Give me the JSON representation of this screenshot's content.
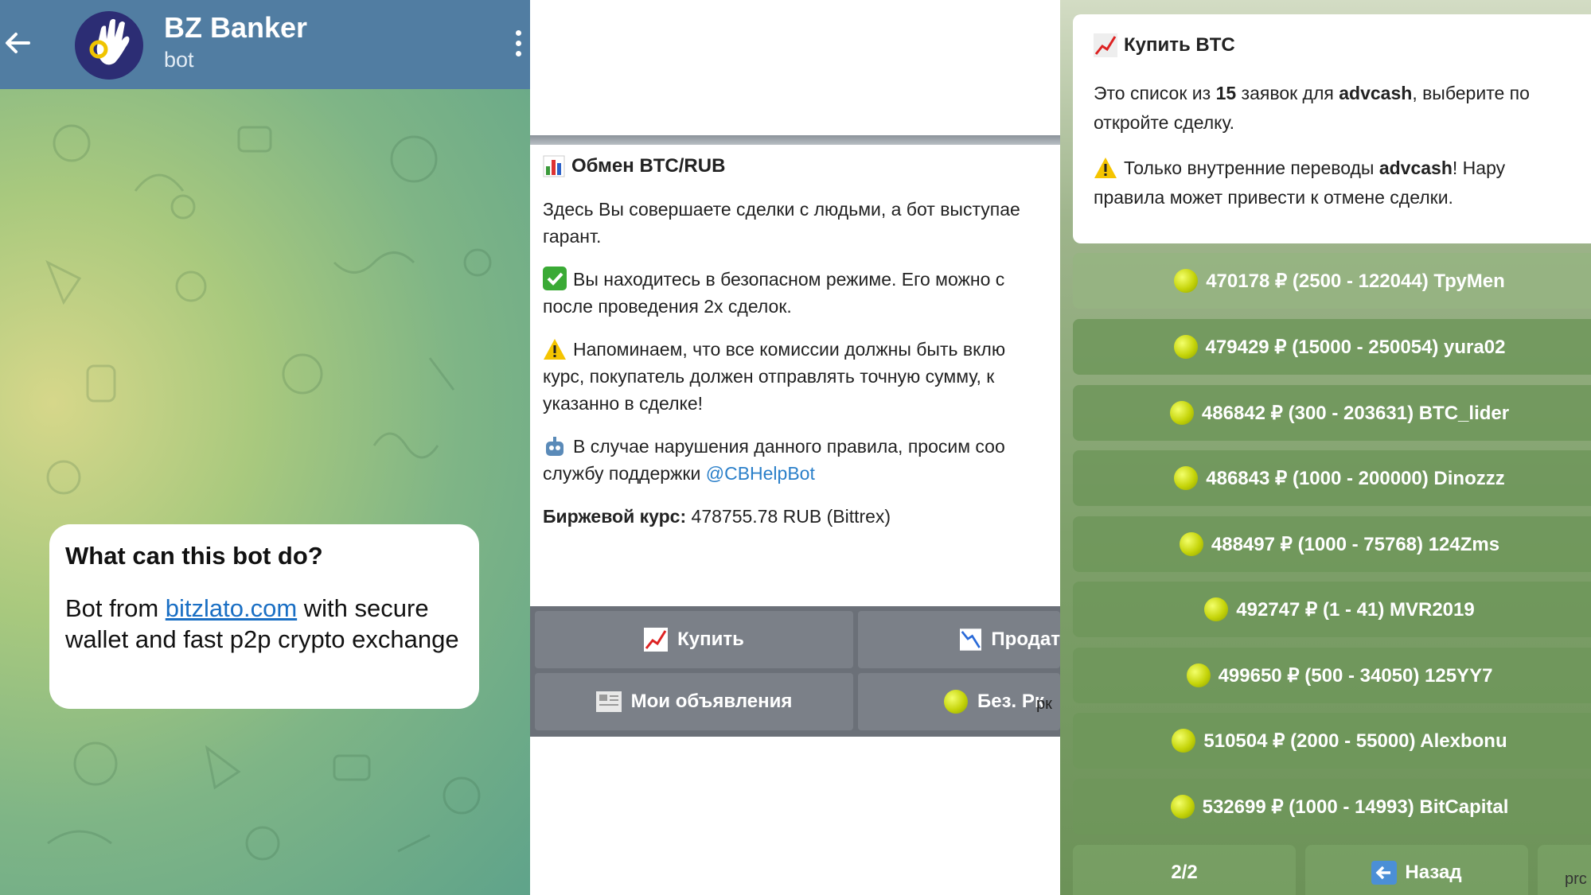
{
  "chat": {
    "title": "BZ Banker",
    "subtitle": "bot",
    "bubble_heading": "What can this bot do?",
    "bubble_prefix": "Bot from ",
    "bubble_link": "bitzlato.com",
    "bubble_suffix": " with secure wallet and fast p2p crypto exchange"
  },
  "exchange": {
    "title": "Обмен BTC/RUB",
    "intro": [
      "Здесь Вы совершаете сделки с людьми, а бот выступае",
      "гарант."
    ],
    "safe_mode": [
      "Вы находитесь в безопасном режиме. Его можно с",
      "после проведения 2х сделок."
    ],
    "reminder": [
      "Напоминаем, что все комиссии должны быть вклю",
      "курс, покупатель должен отправлять точную сумму, к",
      "указанно в сделке!"
    ],
    "violation": [
      "В случае нарушения данного правила, просим соо",
      "службу поддержки "
    ],
    "support_handle": "@CBHelpBot",
    "rate_label": "Биржевой курс:",
    "rate_value": " 478755.78 RUB (Bittrex)",
    "buttons": {
      "buy": "Купить",
      "sell": "Продат",
      "my_ads": "Мои объявления",
      "no_rk": "Без. Рк",
      "small_tag": "рк"
    }
  },
  "buy_btc": {
    "title": "Купить BTC",
    "list_prefix": "Это список из ",
    "list_count": "15",
    "list_mid": " заявок для ",
    "list_method": "advcash",
    "list_suffix": ", выберите по",
    "list_line2": "откройте сделку.",
    "warn_prefix": "Только внутренние переводы ",
    "warn_method": "advcash",
    "warn_suffix": "! Нару",
    "warn_line2": "правила может привести к отмене сделки.",
    "offers": [
      "470178 ₽ (2500 - 122044) ТруМеn",
      "479429 ₽ (15000 - 250054) yura02",
      "486842 ₽ (300 - 203631) BTC_lider",
      "486843 ₽ (1000 - 200000) Dinozzz",
      "488497 ₽ (1000 - 75768) 124Zms",
      "492747 ₽ (1 - 41) MVR2019",
      "499650 ₽ (500 - 34050) 125YY7",
      "510504 ₽ (2000 - 55000) Alexbonu",
      "532699 ₽ (1000 - 14993) BitCapital"
    ],
    "page": "2/2",
    "back": "Назад",
    "small_tag": "prc"
  },
  "colors": {
    "header": "#517da2",
    "link": "#1a6fc4",
    "button_bar": "#6b7078"
  }
}
